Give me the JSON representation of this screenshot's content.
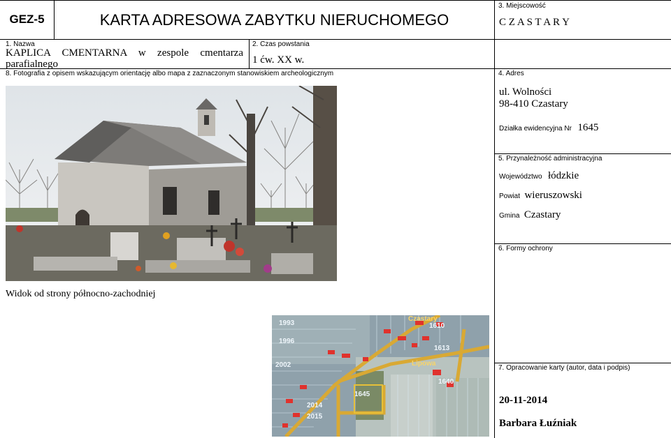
{
  "header": {
    "code": "GEZ-5",
    "title": "KARTA ADRESOWA ZABYTKU NIERUCHOMEGO"
  },
  "fields": {
    "miejscowosc": {
      "label": "3. Miejscowość",
      "value": "C Z A S T A R Y"
    },
    "nazwa": {
      "label": "1. Nazwa",
      "line1": "KAPLICA CMENTARNA w zespole cmentarza",
      "line2": "parafialnego"
    },
    "czas": {
      "label": "2. Czas powstania",
      "value": "1 ćw. XX w."
    },
    "fotografia": {
      "label": "8. Fotografia z opisem wskazującym orientację albo mapa z zaznaczonym stanowiskiem archeologicznym"
    },
    "adres": {
      "label": "4. Adres",
      "street": "ul. Wolności",
      "city": "98-410 Czastary",
      "dzialka_label": "Działka ewidencyjna Nr",
      "dzialka_value": "1645"
    },
    "przynaleznosc": {
      "label": "5. Przynależność administracyjna",
      "woj_label": "Województwo",
      "woj_value": "łódzkie",
      "powiat_label": "Powiat",
      "powiat_value": "wieruszowski",
      "gmina_label": "Gmina",
      "gmina_value": "Czastary"
    },
    "formy": {
      "label": "6. Formy ochrony"
    },
    "opracowanie": {
      "label": "7. Opracowanie karty (autor, data i podpis)",
      "date": "20-11-2014",
      "author": "Barbara Łuźniak"
    }
  },
  "photo_caption": "Widok od strony północno-zachodniej",
  "map_labels": [
    "1993",
    "1996",
    "2002",
    "2014",
    "2015",
    "1645",
    "1610",
    "1613",
    "1640",
    "Lipowa",
    "Czastary"
  ]
}
